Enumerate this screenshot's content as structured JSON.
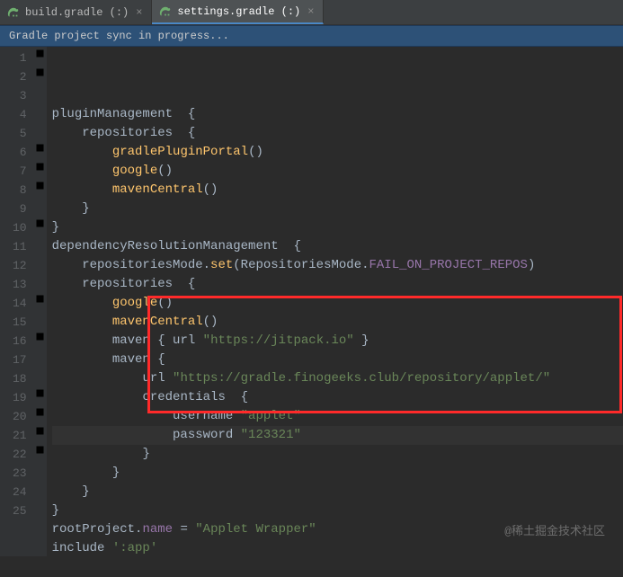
{
  "tabs": [
    {
      "icon": "elephant-icon",
      "label": "build.gradle (:)",
      "active": false
    },
    {
      "icon": "elephant-icon",
      "label": "settings.gradle (:)",
      "active": true
    }
  ],
  "status": "Gradle project sync in progress...",
  "watermark": "@稀土掘金技术社区",
  "lines": [
    {
      "n": 1,
      "fold": "⊟",
      "indent": 0,
      "tokens": [
        [
          "plain",
          "pluginManagement  "
        ],
        [
          "br",
          "{"
        ]
      ]
    },
    {
      "n": 2,
      "fold": "⊟",
      "indent": 1,
      "tokens": [
        [
          "plain",
          "repositories  "
        ],
        [
          "br",
          "{"
        ]
      ]
    },
    {
      "n": 3,
      "fold": "",
      "indent": 2,
      "tokens": [
        [
          "fn",
          "gradlePluginPortal"
        ],
        [
          "br",
          "()"
        ]
      ]
    },
    {
      "n": 4,
      "fold": "",
      "indent": 2,
      "tokens": [
        [
          "fn",
          "google"
        ],
        [
          "br",
          "()"
        ]
      ]
    },
    {
      "n": 5,
      "fold": "",
      "indent": 2,
      "tokens": [
        [
          "fn",
          "mavenCentral"
        ],
        [
          "br",
          "()"
        ]
      ]
    },
    {
      "n": 6,
      "fold": "⊟",
      "indent": 1,
      "tokens": [
        [
          "br",
          "}"
        ]
      ]
    },
    {
      "n": 7,
      "fold": "⊟",
      "indent": 0,
      "tokens": [
        [
          "br",
          "}"
        ]
      ]
    },
    {
      "n": 8,
      "fold": "⊟",
      "indent": 0,
      "tokens": [
        [
          "plain",
          "dependencyResolutionManagement  "
        ],
        [
          "br",
          "{"
        ]
      ]
    },
    {
      "n": 9,
      "fold": "",
      "indent": 1,
      "tokens": [
        [
          "plain",
          "repositoriesMode."
        ],
        [
          "fn",
          "set"
        ],
        [
          "br",
          "("
        ],
        [
          "plain",
          "RepositoriesMode."
        ],
        [
          "prop",
          "FAIL_ON_PROJECT_REPOS"
        ],
        [
          "br",
          ")"
        ]
      ]
    },
    {
      "n": 10,
      "fold": "⊟",
      "indent": 1,
      "tokens": [
        [
          "plain",
          "repositories  "
        ],
        [
          "br",
          "{"
        ]
      ]
    },
    {
      "n": 11,
      "fold": "",
      "indent": 2,
      "tokens": [
        [
          "fn",
          "google"
        ],
        [
          "br",
          "()"
        ]
      ]
    },
    {
      "n": 12,
      "fold": "",
      "indent": 2,
      "tokens": [
        [
          "fn",
          "mavenCentral"
        ],
        [
          "br",
          "()"
        ]
      ]
    },
    {
      "n": 13,
      "fold": "",
      "indent": 2,
      "tokens": [
        [
          "plain",
          "maven "
        ],
        [
          "br",
          "{"
        ],
        [
          "plain",
          " url "
        ],
        [
          "str",
          "\"https://jitpack.io\""
        ],
        [
          "plain",
          " "
        ],
        [
          "br",
          "}"
        ]
      ]
    },
    {
      "n": 14,
      "fold": "⊟",
      "indent": 2,
      "tokens": [
        [
          "plain",
          "maven "
        ],
        [
          "br",
          "{"
        ]
      ]
    },
    {
      "n": 15,
      "fold": "",
      "indent": 3,
      "tokens": [
        [
          "plain",
          "url "
        ],
        [
          "str",
          "\"https://gradle.finogeeks.club/repository/applet/\""
        ]
      ]
    },
    {
      "n": 16,
      "fold": "⊟",
      "indent": 3,
      "tokens": [
        [
          "plain",
          "credentials  "
        ],
        [
          "br",
          "{"
        ]
      ]
    },
    {
      "n": 17,
      "fold": "",
      "indent": 4,
      "tokens": [
        [
          "plain",
          "username "
        ],
        [
          "str",
          "\"applet\""
        ]
      ]
    },
    {
      "n": 18,
      "fold": "",
      "indent": 4,
      "hl": true,
      "tokens": [
        [
          "plain",
          "password "
        ],
        [
          "str",
          "\"123321\""
        ]
      ]
    },
    {
      "n": 19,
      "fold": "⊟",
      "indent": 3,
      "tokens": [
        [
          "br",
          "}"
        ]
      ]
    },
    {
      "n": 20,
      "fold": "⊟",
      "indent": 2,
      "tokens": [
        [
          "br",
          "}"
        ]
      ]
    },
    {
      "n": 21,
      "fold": "⊟",
      "indent": 1,
      "tokens": [
        [
          "br",
          "}"
        ]
      ]
    },
    {
      "n": 22,
      "fold": "⊟",
      "indent": 0,
      "tokens": [
        [
          "br",
          "}"
        ]
      ]
    },
    {
      "n": 23,
      "fold": "",
      "indent": 0,
      "tokens": [
        [
          "plain",
          "rootProject."
        ],
        [
          "prop",
          "name"
        ],
        [
          "plain",
          " = "
        ],
        [
          "str",
          "\"Applet Wrapper\""
        ]
      ]
    },
    {
      "n": 24,
      "fold": "",
      "indent": 0,
      "tokens": [
        [
          "plain",
          "include "
        ],
        [
          "str",
          "':app'"
        ]
      ]
    },
    {
      "n": 25,
      "fold": "",
      "indent": 0,
      "tokens": []
    }
  ]
}
